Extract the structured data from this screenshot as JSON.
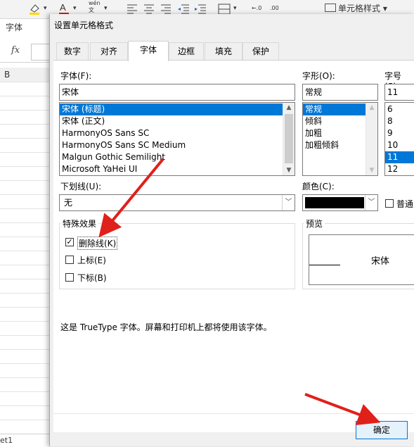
{
  "background": {
    "font_group_label": "字体",
    "fx_label": "fx",
    "column_header": "B",
    "sheet_tab": "et1",
    "ribbon": {
      "phonetic_label": "wén",
      "cell_style_label": "单元格样式",
      "cell_style_icon": "cell-style-icon"
    }
  },
  "dialog": {
    "title": "设置单元格格式",
    "tabs": [
      "数字",
      "对齐",
      "字体",
      "边框",
      "填充",
      "保护"
    ],
    "active_tab": "字体",
    "font": {
      "label": "字体(F):",
      "value": "宋体",
      "options": [
        "宋体 (标题)",
        "宋体 (正文)",
        "HarmonyOS Sans SC",
        "HarmonyOS Sans SC Medium",
        "Malgun Gothic Semilight",
        "Microsoft YaHei UI"
      ],
      "selected": "宋体 (标题)"
    },
    "style": {
      "label": "字形(O):",
      "value": "常规",
      "options": [
        "常规",
        "倾斜",
        "加粗",
        "加粗倾斜"
      ],
      "selected": "常规"
    },
    "size": {
      "label": "字号(S):",
      "value": "11",
      "options": [
        "6",
        "8",
        "9",
        "10",
        "11",
        "12"
      ],
      "selected": "11"
    },
    "underline": {
      "label": "下划线(U):",
      "value": "无"
    },
    "color": {
      "label": "颜色(C):",
      "value": "#000000",
      "normal_font_label": "普通"
    },
    "effects": {
      "title": "特殊效果",
      "items": [
        {
          "label": "删除线(K)",
          "checked": true
        },
        {
          "label": "上标(E)",
          "checked": false
        },
        {
          "label": "下标(B)",
          "checked": false
        }
      ]
    },
    "preview": {
      "title": "预览",
      "sample": "宋体"
    },
    "info_text": "这是 TrueType 字体。屏幕和打印机上都将使用该字体。",
    "ok_label": "确定"
  },
  "colors": {
    "selection": "#0078d7",
    "arrow": "#e0201b"
  }
}
